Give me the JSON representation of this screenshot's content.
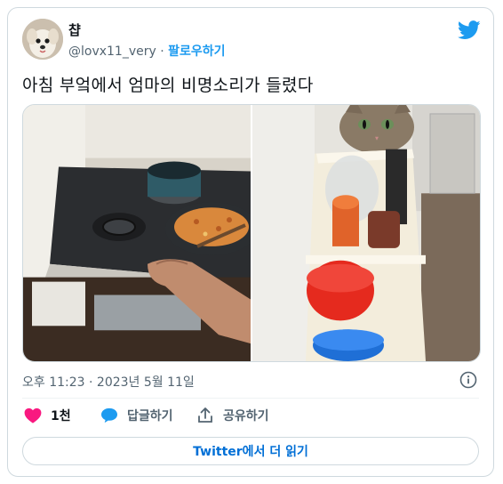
{
  "author": {
    "display_name": "챱",
    "handle": "@lovx11_very",
    "separator": "·",
    "follow_label": "팔로우하기",
    "avatar_icon": "dog-avatar"
  },
  "tweet": {
    "text": "아침 부엌에서 엄마의 비명소리가 들렸다",
    "timestamp": "오후 11:23 · 2023년 5월 11일"
  },
  "media": {
    "left_photo": "kitchen-stove-frying-pan",
    "right_photo": "cat-peeking-from-shelf"
  },
  "actions": {
    "like_count": "1천",
    "reply_label": "답글하기",
    "share_label": "공유하기"
  },
  "read_more_label": "Twitter에서 더 읽기",
  "colors": {
    "accent": "#1d9bf0",
    "like": "#f91880",
    "border": "#cfd9de",
    "muted": "#536471"
  }
}
